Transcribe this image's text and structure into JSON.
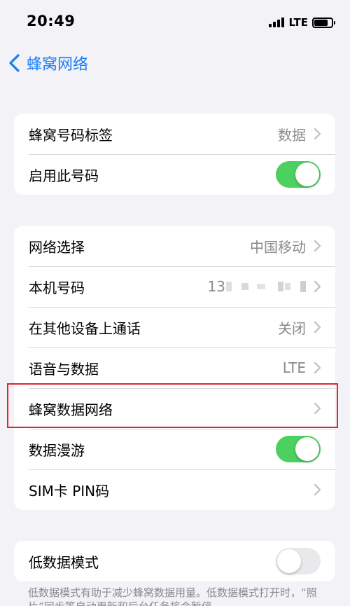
{
  "status_bar": {
    "time": "20:49",
    "network_type": "LTE"
  },
  "nav": {
    "back_label": "蜂窝网络"
  },
  "group1": {
    "rows": [
      {
        "label": "蜂窝号码标签",
        "value": "数据"
      },
      {
        "label": "启用此号码",
        "toggle": "on"
      }
    ]
  },
  "group2": {
    "rows": [
      {
        "label": "网络选择",
        "value": "中国移动"
      },
      {
        "label": "本机号码",
        "value": "13"
      },
      {
        "label": "在其他设备上通话",
        "value": "关闭"
      },
      {
        "label": "语音与数据",
        "value": "LTE"
      },
      {
        "label": "蜂窝数据网络"
      },
      {
        "label": "数据漫游",
        "toggle": "on"
      },
      {
        "label": "SIM卡 PIN码"
      }
    ]
  },
  "group3": {
    "rows": [
      {
        "label": "低数据模式",
        "toggle": "off"
      }
    ]
  },
  "footer_note": "低数据模式有助于减少蜂窝数据用量。低数据模式打开时，“照片”同步等自动更新和后台任务将会暂停。",
  "colors": {
    "accent": "#1a7cf5",
    "toggle_on": "#4cd05f",
    "highlight": "#e0252e"
  }
}
